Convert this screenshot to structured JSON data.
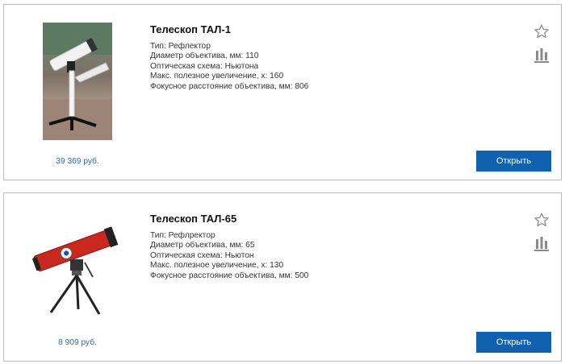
{
  "products": [
    {
      "title": "Телескоп ТАЛ-1",
      "specs": [
        "Тип: Рефлектор",
        "Диаметр объектива, мм: 110",
        "Оптическая схема: Ньютона",
        "Макс. полезное увеличение, x: 160",
        "Фокусное расстояние объектива, мм: 806"
      ],
      "price": "39 369 руб.",
      "button_label": "Открыть"
    },
    {
      "title": "Телескоп ТАЛ-65",
      "specs": [
        "Тип: Рефлректор",
        "Диаметр объектива, мм: 65",
        "Оптическая схема: Ньютон",
        "Макс. полезное увеличение, x: 130",
        "Фокусное расстояние объектива, мм: 500"
      ],
      "price": "8 909 руб.",
      "button_label": "Открыть"
    }
  ],
  "icons": {
    "favorite": "star-icon",
    "compare": "bar-chart-icon"
  },
  "colors": {
    "accent": "#1062b0",
    "price": "#2b6cb0",
    "border": "#b9b9b9",
    "icon": "#8a8a8a"
  }
}
